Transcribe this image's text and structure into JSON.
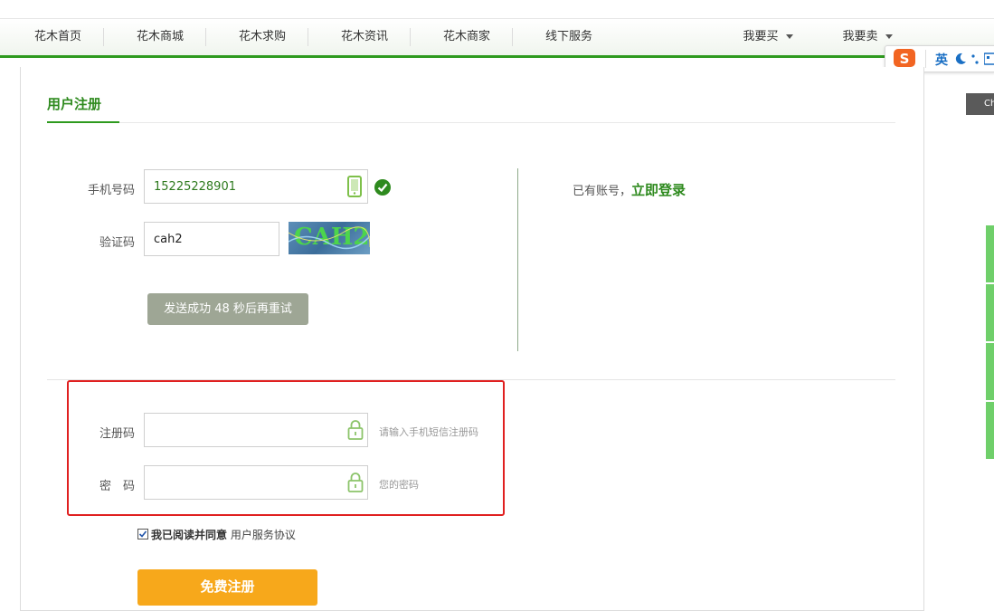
{
  "nav": {
    "items": [
      "花木首页",
      "花木商城",
      "花木求购",
      "花木资讯",
      "花木商家",
      "线下服务"
    ],
    "buy": "我要买",
    "sell": "我要卖"
  },
  "form": {
    "title": "用户注册",
    "phone_label": "手机号码",
    "phone_value": "15225228901",
    "captcha_label": "验证码",
    "captcha_value": "cah2",
    "captcha_image_text": "CAH2",
    "send_status": "发送成功  48  秒后再重试",
    "code_label": "注册码",
    "code_hint": "请输入手机短信注册码",
    "password_label": "密　码",
    "password_hint": "您的密码",
    "agree_text": "我已阅读并同意",
    "agreement_link": "用户服务协议",
    "submit": "免费注册"
  },
  "login": {
    "prompt": "已有账号，",
    "link": "立即登录"
  },
  "ime": {
    "mode": "英"
  },
  "side": {
    "tab": "Ch"
  },
  "colors": {
    "accent": "#2e9a1e",
    "submit": "#f7a81b",
    "highlight_box": "#e02020"
  }
}
